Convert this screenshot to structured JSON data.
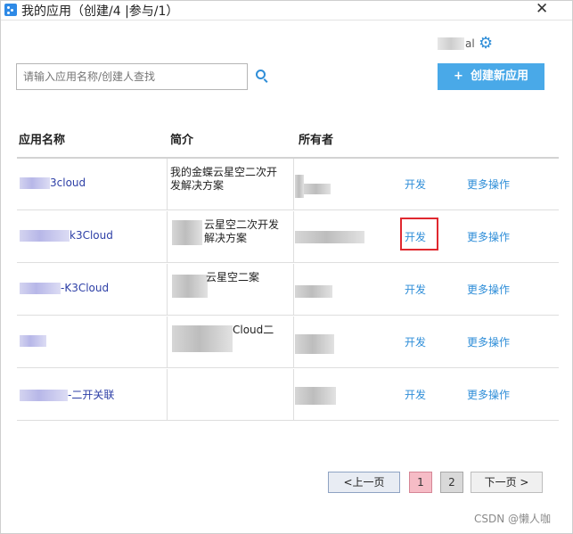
{
  "window": {
    "title": "我的应用（创建/4 |参与/1）",
    "close_glyph": "✕"
  },
  "user": {
    "name_suffix": "al"
  },
  "search": {
    "placeholder": "请输入应用名称/创建人查找",
    "value": "请输入应用名称/创建人查找"
  },
  "create_button": {
    "plus": "+",
    "label": "创建新应用"
  },
  "table": {
    "headers": {
      "name": "应用名称",
      "description": "简介",
      "owner": "所有者"
    },
    "rows": [
      {
        "name": "3cloud",
        "description": "我的金蝶云星空二次开发解决方案",
        "dev": "开发",
        "more": "更多操作"
      },
      {
        "name": "k3Cloud",
        "description": "云星空二次开发解决方案",
        "dev": "开发",
        "more": "更多操作"
      },
      {
        "name": "-K3Cloud",
        "description": "云星空二案",
        "dev": "开发",
        "more": "更多操作"
      },
      {
        "name": "",
        "description": "Cloud二",
        "dev": "开发",
        "more": "更多操作"
      },
      {
        "name": "-二开关联",
        "description": "",
        "dev": "开发",
        "more": "更多操作"
      }
    ]
  },
  "pagination": {
    "prev": "<上一页",
    "page1": "1",
    "page2": "2",
    "next": "下一页 >"
  },
  "watermark": "CSDN @懒人咖",
  "colors": {
    "accent": "#49a9e8",
    "link": "#2f8ed8",
    "highlight": "#e0282f",
    "active_page": "#f6bcc6"
  }
}
